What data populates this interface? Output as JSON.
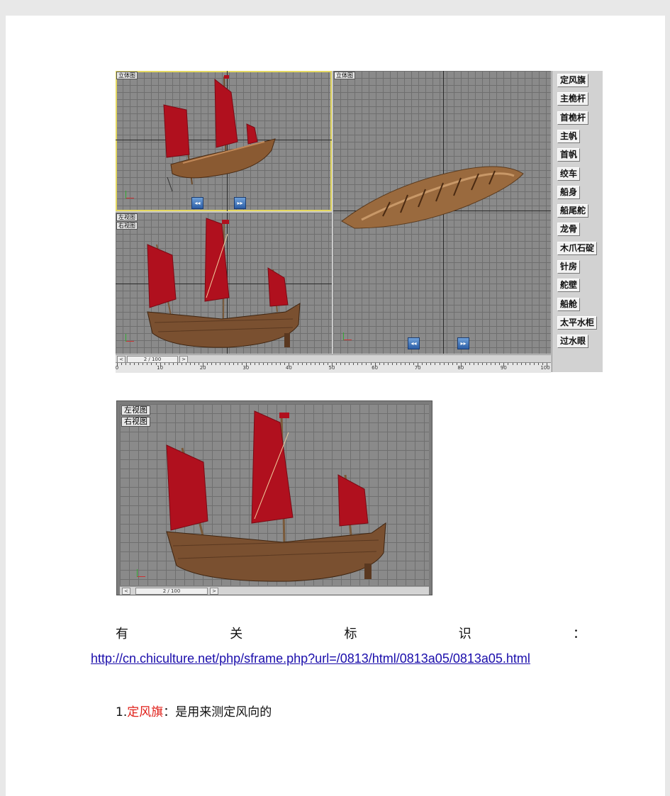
{
  "figure1": {
    "viewports": {
      "top_left_label": "立体图",
      "right_label": "立体图",
      "bottom_left_labels": [
        "左视图",
        "右视图"
      ]
    },
    "nav_buttons": [
      "◂◂",
      "▸▸"
    ],
    "timeline": {
      "left_arrow": "<",
      "frame": "2 / 100",
      "right_arrow": ">"
    },
    "ruler_ticks": [
      "0",
      "10",
      "20",
      "30",
      "40",
      "50",
      "60",
      "70",
      "80",
      "90",
      "100"
    ],
    "object_buttons": [
      "定风旗",
      "主桅杆",
      "首桅杆",
      "主帆",
      "首帆",
      "绞车",
      "船身",
      "船尾舵",
      "龙骨",
      "木爪石碇",
      "针房",
      "舵壁",
      "船舱",
      "太平水柜",
      "过水眼"
    ]
  },
  "figure2": {
    "labels": [
      "左视图",
      "右视图"
    ],
    "timeline": {
      "left_arrow": "<",
      "frame": "2 / 100",
      "right_arrow": ">"
    }
  },
  "text": {
    "title_chars": [
      "有",
      "关",
      "标",
      "识",
      "："
    ],
    "link": "http://cn.chiculture.net/php/sframe.php?url=/0813/html/0813a05/0813a05.html",
    "item1_number": "1.",
    "item1_term": "定风旗",
    "item1_rest": "：是用来测定风向的"
  },
  "colors": {
    "sail_red": "#b0101e",
    "hull_brown": "#7a5030",
    "active_viewport_border": "#e4d860",
    "term_red": "#e0201a",
    "link_blue": "#1a0dab"
  }
}
